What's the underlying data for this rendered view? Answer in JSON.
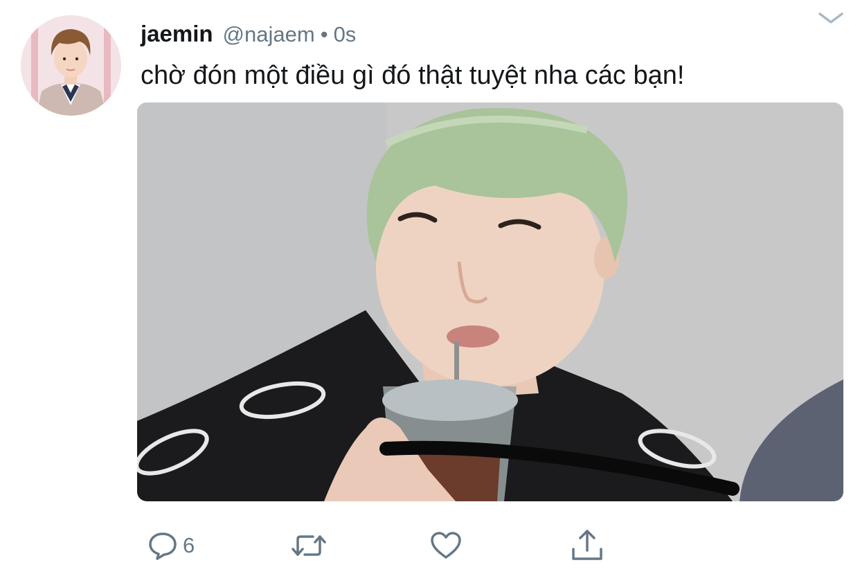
{
  "tweet": {
    "display_name": "jaemin",
    "handle": "@najaem",
    "separator": "•",
    "timestamp": "0s",
    "text": "chờ đón một điều gì đó thật tuyệt nha các bạn!"
  },
  "actions": {
    "reply_count": "6",
    "reply_icon": "reply-icon",
    "retweet_icon": "retweet-icon",
    "like_icon": "heart-icon",
    "share_icon": "share-icon"
  },
  "colors": {
    "text_primary": "#14171a",
    "text_secondary": "#657786",
    "icon": "#657786"
  }
}
